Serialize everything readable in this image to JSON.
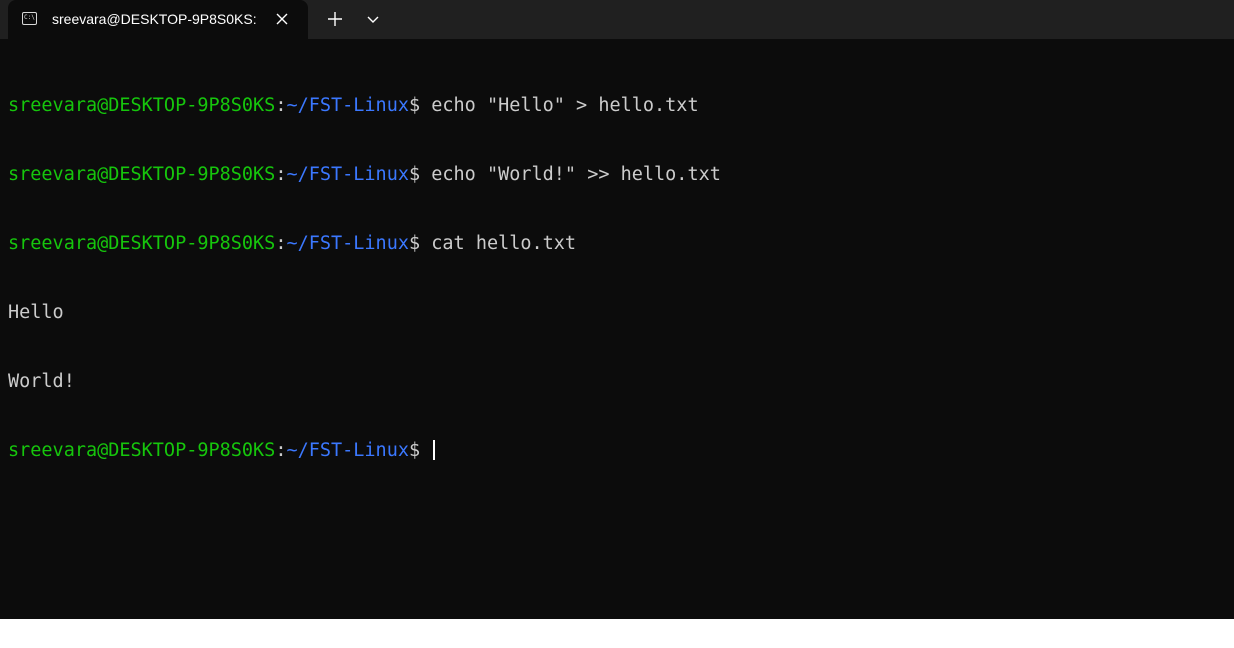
{
  "tab": {
    "icon": "terminal-icon",
    "icon_text": "C:\\",
    "title": "sreevara@DESKTOP-9P8S0KS:",
    "close_icon": "close-icon"
  },
  "toolbar": {
    "new_tab_icon": "plus-icon",
    "dropdown_icon": "chevron-down-icon"
  },
  "colors": {
    "terminal_bg": "#0c0c0c",
    "titlebar_bg": "#202020",
    "user_host": "#16c60c",
    "path": "#3b78ff",
    "text": "#cccccc"
  },
  "terminal": {
    "lines": [
      {
        "user": "sreevara@DESKTOP-9P8S0KS",
        "sep": ":",
        "path": "~/FST-Linux",
        "prompt": "$ ",
        "command": "echo \"Hello\" > hello.txt"
      },
      {
        "user": "sreevara@DESKTOP-9P8S0KS",
        "sep": ":",
        "path": "~/FST-Linux",
        "prompt": "$ ",
        "command": "echo \"World!\" >> hello.txt"
      },
      {
        "user": "sreevara@DESKTOP-9P8S0KS",
        "sep": ":",
        "path": "~/FST-Linux",
        "prompt": "$ ",
        "command": "cat hello.txt"
      },
      {
        "output": "Hello"
      },
      {
        "output": "World!"
      },
      {
        "user": "sreevara@DESKTOP-9P8S0KS",
        "sep": ":",
        "path": "~/FST-Linux",
        "prompt": "$ ",
        "command": ""
      }
    ]
  }
}
